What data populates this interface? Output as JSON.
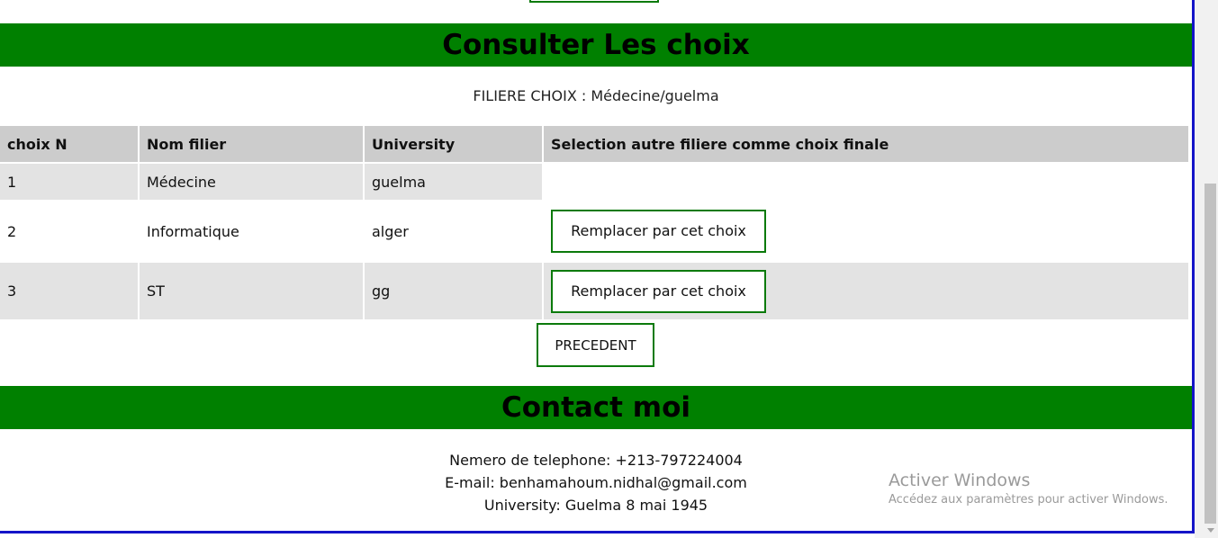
{
  "section_title": "Consulter Les choix",
  "filiere_line": "FILIERE CHOIX : Médecine/guelma",
  "table": {
    "headers": [
      "choix N",
      "Nom filier",
      "University",
      "Selection autre filiere comme choix finale"
    ],
    "rows": [
      {
        "num": "1",
        "name": "Médecine",
        "university": "guelma",
        "action": ""
      },
      {
        "num": "2",
        "name": "Informatique",
        "university": "alger",
        "action": "Remplacer par cet choix"
      },
      {
        "num": "3",
        "name": "ST",
        "university": "gg",
        "action": "Remplacer par cet choix"
      }
    ]
  },
  "prev_label": "PRECEDENT",
  "contact": {
    "title": "Contact moi",
    "phone": "Nemero de telephone: +213-797224004",
    "email": "E-mail: benhamahoum.nidhal@gmail.com",
    "university": "University: Guelma 8 mai 1945"
  },
  "watermark": {
    "line1": "Activer Windows",
    "line2": "Accédez aux paramètres pour activer Windows."
  },
  "colors": {
    "band_green": "#008000",
    "button_border": "#0b7a0b",
    "frame_blue": "#1414c8"
  }
}
